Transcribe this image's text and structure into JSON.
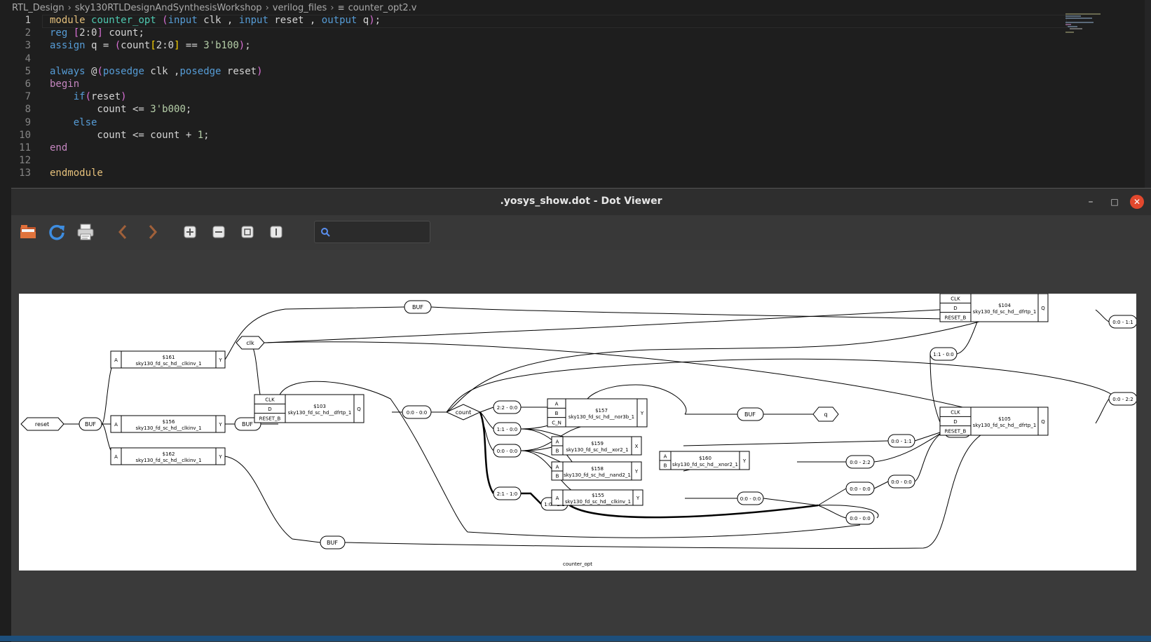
{
  "breadcrumb": [
    "RTL_Design",
    "sky130RTLDesignAndSynthesisWorkshop",
    "verilog_files",
    "counter_opt2.v"
  ],
  "code": {
    "lines": [
      {
        "n": "1",
        "segments": [
          {
            "t": "module ",
            "c": "kw-y"
          },
          {
            "t": "counter_opt ",
            "c": "id-c"
          },
          {
            "t": "(",
            "c": "br"
          },
          {
            "t": "input ",
            "c": "kw-b"
          },
          {
            "t": "clk , ",
            "c": "txt"
          },
          {
            "t": "input ",
            "c": "kw-b"
          },
          {
            "t": "reset , ",
            "c": "txt"
          },
          {
            "t": "output ",
            "c": "kw-b"
          },
          {
            "t": "q",
            "c": "txt"
          },
          {
            "t": ")",
            "c": "br"
          },
          {
            "t": ";",
            "c": "txt"
          }
        ]
      },
      {
        "n": "2",
        "segments": [
          {
            "t": "reg ",
            "c": "kw-b"
          },
          {
            "t": "[",
            "c": "br"
          },
          {
            "t": "2:0",
            "c": "txt"
          },
          {
            "t": "]",
            "c": "br"
          },
          {
            "t": " count;",
            "c": "txt"
          }
        ]
      },
      {
        "n": "3",
        "segments": [
          {
            "t": "assign ",
            "c": "kw-b"
          },
          {
            "t": "q = ",
            "c": "txt"
          },
          {
            "t": "(",
            "c": "br"
          },
          {
            "t": "count",
            "c": "txt"
          },
          {
            "t": "[",
            "c": "br2"
          },
          {
            "t": "2:0",
            "c": "txt"
          },
          {
            "t": "]",
            "c": "br2"
          },
          {
            "t": " == ",
            "c": "txt"
          },
          {
            "t": "3'b100",
            "c": "num"
          },
          {
            "t": ")",
            "c": "br"
          },
          {
            "t": ";",
            "c": "txt"
          }
        ]
      },
      {
        "n": "4",
        "segments": []
      },
      {
        "n": "5",
        "segments": [
          {
            "t": "always ",
            "c": "kw-b"
          },
          {
            "t": "@",
            "c": "txt"
          },
          {
            "t": "(",
            "c": "br"
          },
          {
            "t": "posedge ",
            "c": "kw-b"
          },
          {
            "t": "clk ,",
            "c": "txt"
          },
          {
            "t": "posedge ",
            "c": "kw-b"
          },
          {
            "t": "reset",
            "c": "txt"
          },
          {
            "t": ")",
            "c": "br"
          }
        ]
      },
      {
        "n": "6",
        "segments": [
          {
            "t": "begin",
            "c": "kw-m"
          }
        ]
      },
      {
        "n": "7",
        "segments": [
          {
            "t": "    ",
            "c": "txt"
          },
          {
            "t": "if",
            "c": "kw-b"
          },
          {
            "t": "(",
            "c": "br"
          },
          {
            "t": "reset",
            "c": "txt"
          },
          {
            "t": ")",
            "c": "br"
          }
        ]
      },
      {
        "n": "8",
        "segments": [
          {
            "t": "        count <= ",
            "c": "txt"
          },
          {
            "t": "3'b000",
            "c": "num"
          },
          {
            "t": ";",
            "c": "txt"
          }
        ]
      },
      {
        "n": "9",
        "segments": [
          {
            "t": "    ",
            "c": "txt"
          },
          {
            "t": "else",
            "c": "kw-b"
          }
        ]
      },
      {
        "n": "10",
        "segments": [
          {
            "t": "        count <= count + ",
            "c": "txt"
          },
          {
            "t": "1",
            "c": "num"
          },
          {
            "t": ";",
            "c": "txt"
          }
        ]
      },
      {
        "n": "11",
        "segments": [
          {
            "t": "end",
            "c": "kw-m"
          }
        ]
      },
      {
        "n": "12",
        "segments": []
      },
      {
        "n": "13",
        "segments": [
          {
            "t": "endmodule",
            "c": "kw-y"
          }
        ]
      }
    ]
  },
  "window": {
    "title": ".yosys_show.dot - Dot Viewer",
    "minimize_label": "–",
    "maximize_label": "□",
    "close_label": "✕"
  },
  "toolbar": {
    "icons": [
      "open-icon",
      "reload-icon",
      "print-icon",
      "back-icon",
      "forward-icon",
      "zoom-in-icon",
      "zoom-out-icon",
      "zoom-fit-icon",
      "zoom-100-icon"
    ],
    "search_value": ""
  },
  "graph": {
    "caption": "counter_opt",
    "ports": {
      "reset": "reset",
      "clk": "clk",
      "count": "count",
      "q": "q"
    },
    "buf": "BUF",
    "cells": [
      {
        "id": "$161",
        "type": "sky130_fd_sc_hd__clkinv_1",
        "pins_in": [
          "A"
        ],
        "pins_out": [
          "Y"
        ]
      },
      {
        "id": "$156",
        "type": "sky130_fd_sc_hd__clkinv_1",
        "pins_in": [
          "A"
        ],
        "pins_out": [
          "Y"
        ]
      },
      {
        "id": "$162",
        "type": "sky130_fd_sc_hd__clkinv_1",
        "pins_in": [
          "A"
        ],
        "pins_out": [
          "Y"
        ]
      },
      {
        "id": "$103",
        "type": "sky130_fd_sc_hd__dfrtp_1",
        "pins_in": [
          "CLK",
          "D",
          "RESET_B"
        ],
        "pins_out": [
          "Q"
        ]
      },
      {
        "id": "$157",
        "type": "sky130_fd_sc_hd__nor3b_1",
        "pins_in": [
          "A",
          "B",
          "C_N"
        ],
        "pins_out": [
          "Y"
        ]
      },
      {
        "id": "$159",
        "type": "sky130_fd_sc_hd__xor2_1",
        "pins_in": [
          "A",
          "B"
        ],
        "pins_out": [
          "X"
        ]
      },
      {
        "id": "$158",
        "type": "sky130_fd_sc_hd__nand2_1",
        "pins_in": [
          "A",
          "B"
        ],
        "pins_out": [
          "Y"
        ]
      },
      {
        "id": "$155",
        "type": "sky130_fd_sc_hd__clkinv_1",
        "pins_in": [
          "A"
        ],
        "pins_out": [
          "Y"
        ]
      },
      {
        "id": "$160",
        "type": "sky130_fd_sc_hd__xnor2_1",
        "pins_in": [
          "A",
          "B"
        ],
        "pins_out": [
          "Y"
        ]
      },
      {
        "id": "$104",
        "type": "sky130_fd_sc_hd__dfrtp_1",
        "pins_in": [
          "CLK",
          "D",
          "RESET_B"
        ],
        "pins_out": [
          "Q"
        ]
      },
      {
        "id": "$105",
        "type": "sky130_fd_sc_hd__dfrtp_1",
        "pins_in": [
          "CLK",
          "D",
          "RESET_B"
        ],
        "pins_out": [
          "Q"
        ]
      }
    ],
    "slices": {
      "s0": "0:0 - 0:0",
      "s1": "2:2 - 0:0",
      "s2": "1:1 - 0:0",
      "s3": "0:0 - 0:0",
      "s4": "2:1 - 1:0",
      "s5": "1:0 - 2:1",
      "s6": "0:0 - 1:1",
      "s7": "0:0 - 2:2",
      "s8": "0:0 - 0:0",
      "s9": "0:0 - 0:0",
      "s10": "0:0 - 0:0",
      "s11": "0:0 - 0:0",
      "s12": "1:1 - 0:0",
      "s13": "2:2 - 0:0",
      "s14": "0:0 - 1:1",
      "s15": "0:0 - 2:2"
    }
  }
}
